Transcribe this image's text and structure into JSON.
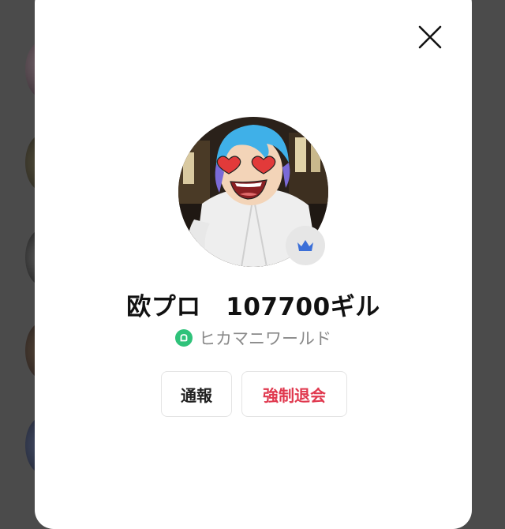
{
  "profile": {
    "name": "欧プロ　107700ギル",
    "community": "ヒカマニワールド",
    "badge_icon": "crown-icon"
  },
  "actions": {
    "report_label": "通報",
    "kick_label": "強制退会"
  },
  "colors": {
    "overlay": "#4b4b4b",
    "modal": "#ffffff",
    "kick_text": "#e0384e",
    "community_icon": "#2fc27a",
    "crown": "#3b6fd8"
  }
}
